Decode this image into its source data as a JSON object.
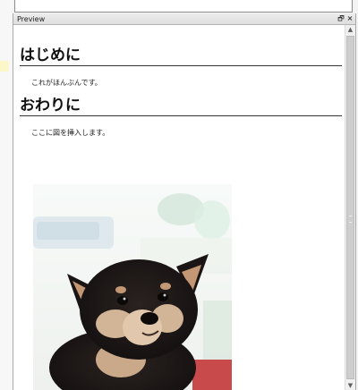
{
  "panel": {
    "title": "Preview",
    "restore_icon": "restore-icon",
    "close_icon": "close-icon",
    "restore_glyph": "🗗",
    "close_glyph": "×"
  },
  "document": {
    "sections": [
      {
        "heading": "はじめに",
        "body": "これがほんぶんです。"
      },
      {
        "heading": "おわりに",
        "body": "ここに図を挿入します。"
      }
    ],
    "image": {
      "subject": "shiba inu puppy photo"
    }
  },
  "scrollbar": {
    "up_glyph": "▲",
    "down_glyph": "▼"
  },
  "colors": {
    "heading_rule": "#333333",
    "panel_header": "#e4e4e4",
    "scroll_thumb": "#cdcdcd"
  }
}
